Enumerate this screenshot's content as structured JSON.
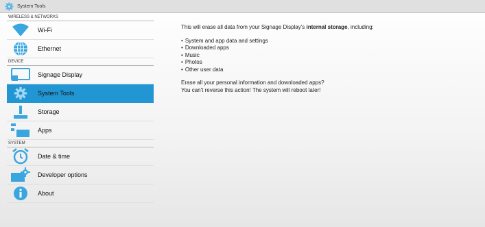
{
  "titlebar": {
    "title": "System Tools",
    "icon": "gear-icon"
  },
  "sections": [
    {
      "header": "WIRELESS & NETWORKS",
      "items": [
        {
          "label": "Wi-Fi",
          "icon": "wifi-icon"
        },
        {
          "label": "Ethernet",
          "icon": "globe-icon"
        }
      ]
    },
    {
      "header": "DEVICE",
      "items": [
        {
          "label": "Signage Display",
          "icon": "display-icon"
        },
        {
          "label": "System Tools",
          "icon": "gear-icon",
          "selected": true
        },
        {
          "label": "Storage",
          "icon": "storage-icon"
        },
        {
          "label": "Apps",
          "icon": "apps-icon"
        }
      ]
    },
    {
      "header": "SYSTEM",
      "items": [
        {
          "label": "Date & time",
          "icon": "clock-icon"
        },
        {
          "label": "Developer options",
          "icon": "developer-icon"
        },
        {
          "label": "About",
          "icon": "info-icon"
        }
      ]
    }
  ],
  "content": {
    "intro_before": "This will erase all data from your Signage Display's ",
    "intro_bold": "internal storage",
    "intro_after": ", including:",
    "bullets": [
      "System and app data and settings",
      "Downloaded apps",
      "Music",
      "Photos",
      "Other user data"
    ],
    "warning_line1": "Erase all your personal information and downloaded apps?",
    "warning_line2": "You can't reverse this action! The system will reboot later!"
  },
  "colors": {
    "accent": "#2196d3",
    "titlebar": "#e0e0e0"
  }
}
